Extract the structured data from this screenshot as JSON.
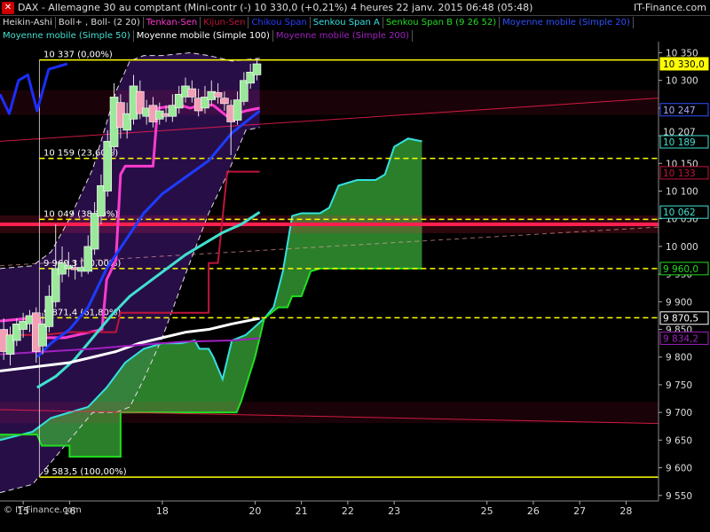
{
  "header": {
    "title": "DAX - Allemagne 30 au comptant (Mini-contr (-)    10 330,0 (+0,21%)    4 heures  22 janv. 2015 06:48 (05:48)",
    "brand": "IT-Finance.com"
  },
  "indicators_row1": [
    {
      "label": "Heikin-Ashi",
      "color": "#dddddd"
    },
    {
      "label": "Boll+ , Boll- (2 20)",
      "color": "#dddddd"
    },
    {
      "label": "Tenkan-Sen",
      "color": "#ff3bd0"
    },
    {
      "label": "Kijun-Sen",
      "color": "#c0143c"
    },
    {
      "label": "Chikou Span",
      "color": "#2a3cff"
    },
    {
      "label": "Senkou Span A",
      "color": "#35e0e0"
    },
    {
      "label": "Senkou Span B (9 26 52)",
      "color": "#22dd22"
    },
    {
      "label": "Moyenne mobile (Simple 20)",
      "color": "#3050ff"
    }
  ],
  "indicators_row2": [
    {
      "label": "Moyenne mobile (Simple 50)",
      "color": "#40e0d0"
    },
    {
      "label": "Moyenne mobile (Simple 100)",
      "color": "#ffffff"
    },
    {
      "label": "Moyenne mobile (Simple 200)",
      "color": "#a020c0"
    }
  ],
  "watermark": "© IT-Finance.com",
  "chart_data": {
    "type": "candlestick",
    "ylim": [
      9540,
      10370
    ],
    "xlim": [
      14.5,
      28.7
    ],
    "y_ticks": [
      9550,
      9600,
      9650,
      9700,
      9750,
      9800,
      9850,
      9900,
      9950,
      10000,
      10050,
      10100,
      10150,
      10200,
      10250,
      10300,
      10350
    ],
    "y_tick_labels": [
      "9 550",
      "9 600",
      "9 650",
      "9 700",
      "9 750",
      "9 800",
      "9 850",
      "9 900",
      "9 950",
      "10 000",
      "10 050",
      "10 100",
      "10 150",
      "10 200",
      "10 250",
      "10 300",
      "10 350"
    ],
    "x_ticks": [
      15,
      16,
      18,
      20,
      21,
      22,
      23,
      25,
      26,
      27,
      28
    ],
    "x_tick_labels": [
      "15",
      "16",
      "18",
      "20",
      "21",
      "22",
      "23",
      "25",
      "26",
      "27",
      "28"
    ],
    "fibonacci": [
      {
        "label": "10 337 (0,00%)",
        "value": 10337,
        "color": "#ffff00"
      },
      {
        "label": "10 159 (23,60%)",
        "value": 10159,
        "color": "#ffff00"
      },
      {
        "label": "10 049 (38,20%)",
        "value": 10049,
        "color": "#ffff00"
      },
      {
        "label": "9 960,3 (50,00%)",
        "value": 9960,
        "color": "#ffff00"
      },
      {
        "label": "9 871,4 (61,80%)",
        "value": 9871,
        "color": "#ffff00"
      },
      {
        "label": "9 583,5 (100,00%)",
        "value": 9583,
        "color": "#ffff00"
      }
    ],
    "horizontal_levels": [
      {
        "value": 10040,
        "color": "#ff2050"
      }
    ],
    "price_tags": [
      {
        "label": "10 330,0",
        "value": 10330,
        "bg": "#ffff00",
        "fg": "#000000",
        "border": "#ffff00"
      },
      {
        "label": "10 247",
        "value": 10247,
        "bg": "#000000",
        "fg": "#aaaaff",
        "border": "#3050ff"
      },
      {
        "label": "10 207",
        "value": 10207,
        "bg": "#000000",
        "fg": "#dddddd",
        "border": "#000000"
      },
      {
        "label": "10 189",
        "value": 10189,
        "bg": "#000000",
        "fg": "#40e0d0",
        "border": "#40e0d0"
      },
      {
        "label": "10 133",
        "value": 10133,
        "bg": "#000000",
        "fg": "#c0143c",
        "border": "#c0143c"
      },
      {
        "label": "10 062",
        "value": 10062,
        "bg": "#000000",
        "fg": "#40e0d0",
        "border": "#40e0d0"
      },
      {
        "label": "9 960,0",
        "value": 9960,
        "bg": "#000000",
        "fg": "#22dd22",
        "border": "#22dd22"
      },
      {
        "label": "9 870,5",
        "value": 9870.5,
        "bg": "#000000",
        "fg": "#ffffff",
        "border": "#ffffff"
      },
      {
        "label": "9 834,2",
        "value": 9834.2,
        "bg": "#000000",
        "fg": "#a020c0",
        "border": "#a020c0"
      }
    ],
    "candles": [
      {
        "x": 14.58,
        "o": 9850,
        "c": 9810,
        "h": 9870,
        "l": 9795
      },
      {
        "x": 14.72,
        "o": 9805,
        "c": 9840,
        "h": 9855,
        "l": 9785
      },
      {
        "x": 14.86,
        "o": 9830,
        "c": 9860,
        "h": 9870,
        "l": 9820
      },
      {
        "x": 15.0,
        "o": 9850,
        "c": 9865,
        "h": 9880,
        "l": 9835
      },
      {
        "x": 15.14,
        "o": 9860,
        "c": 9875,
        "h": 9885,
        "l": 9845
      },
      {
        "x": 15.28,
        "o": 9880,
        "c": 9810,
        "h": 9890,
        "l": 9790
      },
      {
        "x": 15.42,
        "o": 9820,
        "c": 9860,
        "h": 9880,
        "l": 9805
      },
      {
        "x": 15.56,
        "o": 9855,
        "c": 9910,
        "h": 9930,
        "l": 9845
      },
      {
        "x": 15.7,
        "o": 9900,
        "c": 9960,
        "h": 10040,
        "l": 9890
      },
      {
        "x": 15.84,
        "o": 9950,
        "c": 9970,
        "h": 10000,
        "l": 9935
      },
      {
        "x": 15.98,
        "o": 9960,
        "c": 9965,
        "h": 9990,
        "l": 9945
      },
      {
        "x": 16.12,
        "o": 9962,
        "c": 9958,
        "h": 9975,
        "l": 9940
      },
      {
        "x": 16.26,
        "o": 9955,
        "c": 9962,
        "h": 9980,
        "l": 9945
      },
      {
        "x": 16.4,
        "o": 9955,
        "c": 10000,
        "h": 10020,
        "l": 9950
      },
      {
        "x": 16.54,
        "o": 9995,
        "c": 10060,
        "h": 10080,
        "l": 9985
      },
      {
        "x": 16.68,
        "o": 10055,
        "c": 10110,
        "h": 10130,
        "l": 10040
      },
      {
        "x": 16.82,
        "o": 10100,
        "c": 10190,
        "h": 10210,
        "l": 10090
      },
      {
        "x": 16.96,
        "o": 10180,
        "c": 10270,
        "h": 10295,
        "l": 10170
      },
      {
        "x": 17.1,
        "o": 10260,
        "c": 10215,
        "h": 10275,
        "l": 10195
      },
      {
        "x": 17.24,
        "o": 10210,
        "c": 10240,
        "h": 10260,
        "l": 10195
      },
      {
        "x": 17.38,
        "o": 10230,
        "c": 10290,
        "h": 10310,
        "l": 10220
      },
      {
        "x": 17.52,
        "o": 10280,
        "c": 10240,
        "h": 10300,
        "l": 10230
      },
      {
        "x": 17.66,
        "o": 10235,
        "c": 10250,
        "h": 10265,
        "l": 10220
      },
      {
        "x": 17.8,
        "o": 10255,
        "c": 10225,
        "h": 10270,
        "l": 10215
      },
      {
        "x": 17.94,
        "o": 10230,
        "c": 10245,
        "h": 10260,
        "l": 10220
      },
      {
        "x": 18.08,
        "o": 10240,
        "c": 10235,
        "h": 10255,
        "l": 10225
      },
      {
        "x": 18.22,
        "o": 10235,
        "c": 10255,
        "h": 10275,
        "l": 10225
      },
      {
        "x": 18.36,
        "o": 10250,
        "c": 10275,
        "h": 10290,
        "l": 10240
      },
      {
        "x": 18.5,
        "o": 10270,
        "c": 10290,
        "h": 10305,
        "l": 10260
      },
      {
        "x": 18.64,
        "o": 10285,
        "c": 10270,
        "h": 10300,
        "l": 10260
      },
      {
        "x": 18.78,
        "o": 10268,
        "c": 10245,
        "h": 10285,
        "l": 10235
      },
      {
        "x": 18.92,
        "o": 10250,
        "c": 10270,
        "h": 10290,
        "l": 10240
      },
      {
        "x": 19.06,
        "o": 10265,
        "c": 10280,
        "h": 10300,
        "l": 10255
      },
      {
        "x": 19.2,
        "o": 10278,
        "c": 10270,
        "h": 10295,
        "l": 10258
      },
      {
        "x": 19.34,
        "o": 10268,
        "c": 10258,
        "h": 10280,
        "l": 10245
      },
      {
        "x": 19.48,
        "o": 10255,
        "c": 10225,
        "h": 10265,
        "l": 10165
      },
      {
        "x": 19.62,
        "o": 10228,
        "c": 10265,
        "h": 10280,
        "l": 10220
      },
      {
        "x": 19.76,
        "o": 10262,
        "c": 10300,
        "h": 10315,
        "l": 10255
      },
      {
        "x": 19.9,
        "o": 10295,
        "c": 10315,
        "h": 10330,
        "l": 10285
      },
      {
        "x": 20.04,
        "o": 10310,
        "c": 10330,
        "h": 10340,
        "l": 10300
      }
    ],
    "series": [
      {
        "key": "tenkan",
        "color": "#ff3bd0",
        "width": 3,
        "points": [
          [
            14.5,
            9865
          ],
          [
            15.1,
            9870
          ],
          [
            15.35,
            9870
          ],
          [
            15.45,
            9835
          ],
          [
            15.6,
            9835
          ],
          [
            15.9,
            9835
          ],
          [
            16.7,
            9850
          ],
          [
            16.8,
            9940
          ],
          [
            17.0,
            9975
          ],
          [
            17.1,
            10130
          ],
          [
            17.2,
            10145
          ],
          [
            17.8,
            10145
          ],
          [
            17.9,
            10250
          ],
          [
            18.4,
            10255
          ],
          [
            18.6,
            10250
          ],
          [
            18.8,
            10255
          ],
          [
            19.1,
            10255
          ],
          [
            19.4,
            10235
          ],
          [
            19.6,
            10240
          ],
          [
            19.8,
            10245
          ],
          [
            20.1,
            10250
          ]
        ]
      },
      {
        "key": "kijun",
        "color": "#c0143c",
        "width": 2,
        "points": [
          [
            14.5,
            9840
          ],
          [
            15.4,
            9840
          ],
          [
            15.45,
            9840
          ],
          [
            16.0,
            9845
          ],
          [
            17.0,
            9845
          ],
          [
            17.1,
            9880
          ],
          [
            19.0,
            9880
          ],
          [
            19.0,
            9970
          ],
          [
            19.2,
            9970
          ],
          [
            19.4,
            10135
          ],
          [
            20.1,
            10135
          ]
        ]
      },
      {
        "key": "chikou",
        "color": "#1c2eff",
        "width": 3,
        "points": [
          [
            14.5,
            10275
          ],
          [
            14.7,
            10240
          ],
          [
            14.9,
            10300
          ],
          [
            15.1,
            10310
          ],
          [
            15.3,
            10245
          ],
          [
            15.55,
            10320
          ],
          [
            15.75,
            10325
          ],
          [
            15.95,
            10330
          ]
        ]
      },
      {
        "key": "sma20",
        "color": "#1c3cff",
        "width": 3,
        "points": [
          [
            15.3,
            9800
          ],
          [
            15.6,
            9825
          ],
          [
            16.0,
            9850
          ],
          [
            16.4,
            9890
          ],
          [
            16.8,
            9960
          ],
          [
            17.2,
            10010
          ],
          [
            17.6,
            10060
          ],
          [
            18.0,
            10095
          ],
          [
            18.5,
            10125
          ],
          [
            19.0,
            10155
          ],
          [
            19.5,
            10205
          ],
          [
            20.1,
            10245
          ]
        ]
      },
      {
        "key": "sma50",
        "color": "#40e0d0",
        "width": 3,
        "points": [
          [
            15.3,
            9745
          ],
          [
            15.7,
            9765
          ],
          [
            16.1,
            9795
          ],
          [
            16.5,
            9835
          ],
          [
            16.9,
            9875
          ],
          [
            17.3,
            9910
          ],
          [
            17.7,
            9935
          ],
          [
            18.1,
            9960
          ],
          [
            18.5,
            9985
          ],
          [
            18.9,
            10005
          ],
          [
            19.3,
            10025
          ],
          [
            19.7,
            10040
          ],
          [
            20.1,
            10062
          ]
        ]
      },
      {
        "key": "sma100",
        "color": "#ffffff",
        "width": 3,
        "points": [
          [
            14.5,
            9775
          ],
          [
            15.0,
            9780
          ],
          [
            15.5,
            9785
          ],
          [
            16.0,
            9790
          ],
          [
            16.5,
            9800
          ],
          [
            17.0,
            9810
          ],
          [
            17.5,
            9825
          ],
          [
            18.0,
            9835
          ],
          [
            18.5,
            9845
          ],
          [
            19.0,
            9850
          ],
          [
            19.5,
            9860
          ],
          [
            20.1,
            9870
          ]
        ]
      },
      {
        "key": "sma200",
        "color": "#a020c0",
        "width": 2,
        "points": [
          [
            14.5,
            9805
          ],
          [
            15.5,
            9810
          ],
          [
            16.5,
            9815
          ],
          [
            17.5,
            9822
          ],
          [
            18.5,
            9828
          ],
          [
            19.5,
            9830
          ],
          [
            20.1,
            9834
          ]
        ]
      }
    ],
    "cloud": {
      "span_a": [
        [
          14.5,
          9650
        ],
        [
          15.2,
          9665
        ],
        [
          15.6,
          9690
        ],
        [
          16.0,
          9700
        ],
        [
          16.4,
          9710
        ],
        [
          16.8,
          9745
        ],
        [
          17.2,
          9790
        ],
        [
          17.6,
          9815
        ],
        [
          18.0,
          9825
        ],
        [
          18.4,
          9825
        ],
        [
          18.7,
          9830
        ],
        [
          18.8,
          9815
        ],
        [
          19.0,
          9815
        ],
        [
          19.1,
          9800
        ],
        [
          19.3,
          9760
        ],
        [
          19.5,
          9830
        ],
        [
          19.8,
          9840
        ],
        [
          20.2,
          9870
        ],
        [
          20.4,
          9890
        ],
        [
          20.6,
          9955
        ],
        [
          20.8,
          10055
        ],
        [
          21.0,
          10060
        ],
        [
          21.4,
          10060
        ],
        [
          21.6,
          10070
        ],
        [
          21.8,
          10110
        ],
        [
          22.2,
          10120
        ],
        [
          22.6,
          10120
        ],
        [
          22.8,
          10130
        ],
        [
          23.0,
          10180
        ],
        [
          23.3,
          10195
        ],
        [
          23.6,
          10190
        ]
      ],
      "span_b": [
        [
          14.5,
          9660
        ],
        [
          15.3,
          9660
        ],
        [
          15.4,
          9640
        ],
        [
          16.0,
          9640
        ],
        [
          16.0,
          9620
        ],
        [
          17.1,
          9620
        ],
        [
          17.1,
          9700
        ],
        [
          19.6,
          9700
        ],
        [
          19.7,
          9720
        ],
        [
          20.0,
          9800
        ],
        [
          20.2,
          9870
        ],
        [
          20.5,
          9890
        ],
        [
          20.7,
          9890
        ],
        [
          20.8,
          9910
        ],
        [
          21.0,
          9910
        ],
        [
          21.2,
          9955
        ],
        [
          21.4,
          9960
        ],
        [
          23.6,
          9960
        ]
      ],
      "bull_color": "#3aaa3a",
      "bear_color": "#7a1a30"
    },
    "bollinger": {
      "upper": [
        [
          14.5,
          9960
        ],
        [
          15.2,
          9965
        ],
        [
          15.6,
          9990
        ],
        [
          16.0,
          10050
        ],
        [
          16.5,
          10140
        ],
        [
          17.0,
          10280
        ],
        [
          17.3,
          10335
        ],
        [
          17.6,
          10345
        ],
        [
          18.0,
          10345
        ],
        [
          18.6,
          10350
        ],
        [
          19.0,
          10345
        ],
        [
          19.5,
          10335
        ],
        [
          20.1,
          10340
        ]
      ],
      "lower": [
        [
          14.5,
          9555
        ],
        [
          15.2,
          9570
        ],
        [
          15.6,
          9610
        ],
        [
          16.0,
          9650
        ],
        [
          16.5,
          9700
        ],
        [
          17.0,
          9700
        ],
        [
          17.3,
          9710
        ],
        [
          17.6,
          9760
        ],
        [
          18.0,
          9835
        ],
        [
          18.5,
          9950
        ],
        [
          19.0,
          10060
        ],
        [
          19.4,
          10130
        ],
        [
          19.8,
          10210
        ],
        [
          20.1,
          10215
        ]
      ]
    }
  }
}
